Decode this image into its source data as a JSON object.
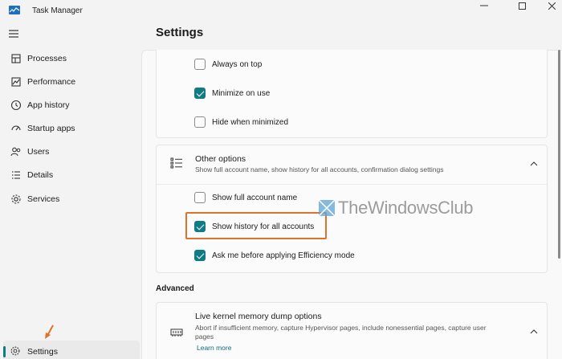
{
  "window": {
    "title": "Task Manager"
  },
  "nav": {
    "items": [
      {
        "label": "Processes",
        "icon": "processes-icon"
      },
      {
        "label": "Performance",
        "icon": "performance-icon"
      },
      {
        "label": "App history",
        "icon": "app-history-icon"
      },
      {
        "label": "Startup apps",
        "icon": "startup-apps-icon"
      },
      {
        "label": "Users",
        "icon": "users-icon"
      },
      {
        "label": "Details",
        "icon": "details-icon"
      },
      {
        "label": "Services",
        "icon": "services-icon"
      }
    ],
    "settings_label": "Settings"
  },
  "page": {
    "title": "Settings"
  },
  "window_options": {
    "always_on_top": {
      "label": "Always on top",
      "checked": false
    },
    "minimize_on_use": {
      "label": "Minimize on use",
      "checked": true
    },
    "hide_when_minimized": {
      "label": "Hide when minimized",
      "checked": false
    }
  },
  "other_options": {
    "title": "Other options",
    "description": "Show full account name, show history for all accounts, confirmation dialog settings",
    "show_full_account_name": {
      "label": "Show full account name",
      "checked": false
    },
    "show_history_all_accounts": {
      "label": "Show history for all accounts",
      "checked": true
    },
    "ask_before_efficiency": {
      "label": "Ask me before applying Efficiency mode",
      "checked": true
    }
  },
  "advanced": {
    "heading": "Advanced",
    "kernel_dump": {
      "title": "Live kernel memory dump options",
      "description": "Abort if insufficient memory, capture Hypervisor pages, include nonessential pages, capture user pages",
      "link": "Learn more"
    }
  },
  "watermark": "TheWindowsClub",
  "colors": {
    "accent": "#0f7b85",
    "highlight": "#e0712b"
  }
}
